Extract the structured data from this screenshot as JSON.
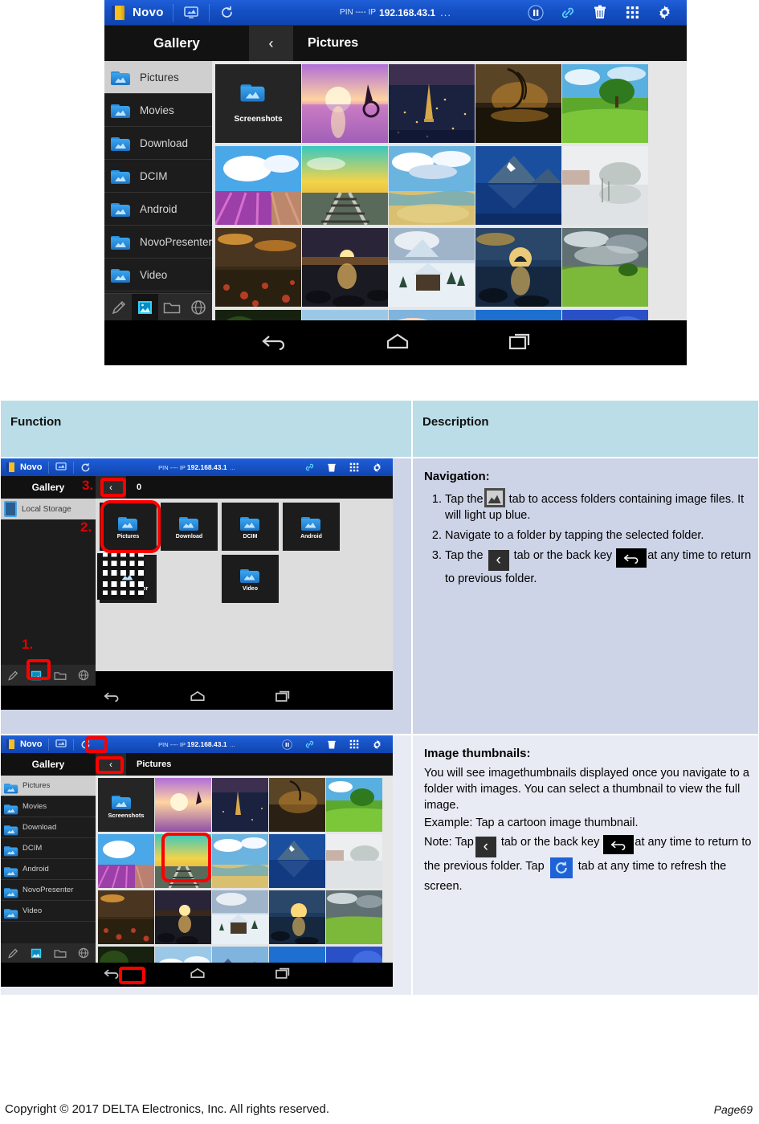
{
  "hero": {
    "toolbar": {
      "app_name": "Novo",
      "pin_label": "PIN ---- IP",
      "ip": "192.168.43.1",
      "more": "...",
      "icons": [
        "novo-logo-icon",
        "display-icon",
        "refresh-icon",
        "pause-icon",
        "link-icon",
        "trash-icon",
        "apps-grid-icon",
        "settings-gear-icon"
      ]
    },
    "header": {
      "gallery_label": "Gallery",
      "back_chevron": "‹",
      "breadcrumb": "Pictures"
    },
    "sidebar": {
      "items": [
        {
          "label": "Pictures",
          "selected": true
        },
        {
          "label": "Movies",
          "selected": false
        },
        {
          "label": "Download",
          "selected": false
        },
        {
          "label": "DCIM",
          "selected": false
        },
        {
          "label": "Android",
          "selected": false
        },
        {
          "label": "NovoPresenter",
          "selected": false
        },
        {
          "label": "Video",
          "selected": false
        }
      ],
      "tools": [
        "pen-icon",
        "image-icon",
        "folder-icon",
        "globe-icon"
      ]
    },
    "grid": {
      "folder_label": "Screenshots"
    },
    "navbar": [
      "back-icon",
      "home-icon",
      "recents-icon"
    ]
  },
  "table": {
    "headers": {
      "function": "Function",
      "description": "Description"
    },
    "rows": [
      {
        "title": "Navigation:",
        "steps": [
          {
            "pre": "Tap the",
            "icon": "image-tab-icon",
            "post": "tab to access folders containing image files. It will light up blue."
          },
          {
            "pre": "Navigate to a folder by tapping the selected folder.",
            "icon": "",
            "post": ""
          },
          {
            "pre": "Tap the",
            "icon": "back-chevron-icon",
            "mid": "tab or the back key",
            "icon2": "back-key-icon",
            "post": "at any time to return to previous folder."
          }
        ],
        "screenshot": {
          "toolbar": {
            "app_name": "Novo",
            "pin_label": "PIN ---- IP",
            "ip": "192.168.43.1",
            "more": "..."
          },
          "header": {
            "gallery_label": "Gallery",
            "back_chevron": "‹",
            "breadcrumb": "0"
          },
          "sidebar_item": "Local Storage",
          "folders": [
            "Pictures",
            "Download",
            "DCIM",
            "Android",
            "NovoPresenter",
            "Video"
          ],
          "annotations": [
            {
              "num": "1.",
              "target": "image-tool-icon"
            },
            {
              "num": "2.",
              "target": "pictures-folder-tile"
            },
            {
              "num": "3.",
              "target": "back-chevron-tab"
            }
          ]
        }
      },
      {
        "title": "Image thumbnails:",
        "paragraphs": [
          "You will see imagethumbnails displayed once you navigate to a folder with images. You can select a thumbnail to view the full image.",
          "Example: Tap a cartoon image thumbnail."
        ],
        "note": {
          "pre": "Note: Tap",
          "icon": "back-chevron-icon",
          "mid": "tab or the back key",
          "icon2": "back-key-icon",
          "mid2": "at any time to return to the previous folder. Tap",
          "icon3": "refresh-icon",
          "post": "tab at any time to refresh the screen."
        },
        "screenshot": {
          "toolbar": {
            "app_name": "Novo",
            "pin_label": "PIN ---- IP",
            "ip": "192.168.43.1",
            "more": "..."
          },
          "header": {
            "gallery_label": "Gallery",
            "back_chevron": "‹",
            "breadcrumb": "Pictures"
          },
          "sidebar": [
            "Pictures",
            "Movies",
            "Download",
            "DCIM",
            "Android",
            "NovoPresenter",
            "Video"
          ],
          "folder_tile": "Screenshots",
          "annotations": [
            {
              "target": "refresh-icon"
            },
            {
              "target": "back-chevron-tab"
            },
            {
              "target": "thumbnail-railway"
            },
            {
              "target": "back-key"
            }
          ]
        }
      }
    ]
  },
  "footer": {
    "copyright": "Copyright © 2017 DELTA Electronics, Inc. All rights reserved.",
    "page": "Page69"
  },
  "colors": {
    "header_bg": "#bbdde7",
    "row1_bg": "#ced4e7",
    "row2_bg": "#e8ebf3",
    "toolbar_blue": "#1550c4",
    "highlight_red": "#ff0000"
  }
}
